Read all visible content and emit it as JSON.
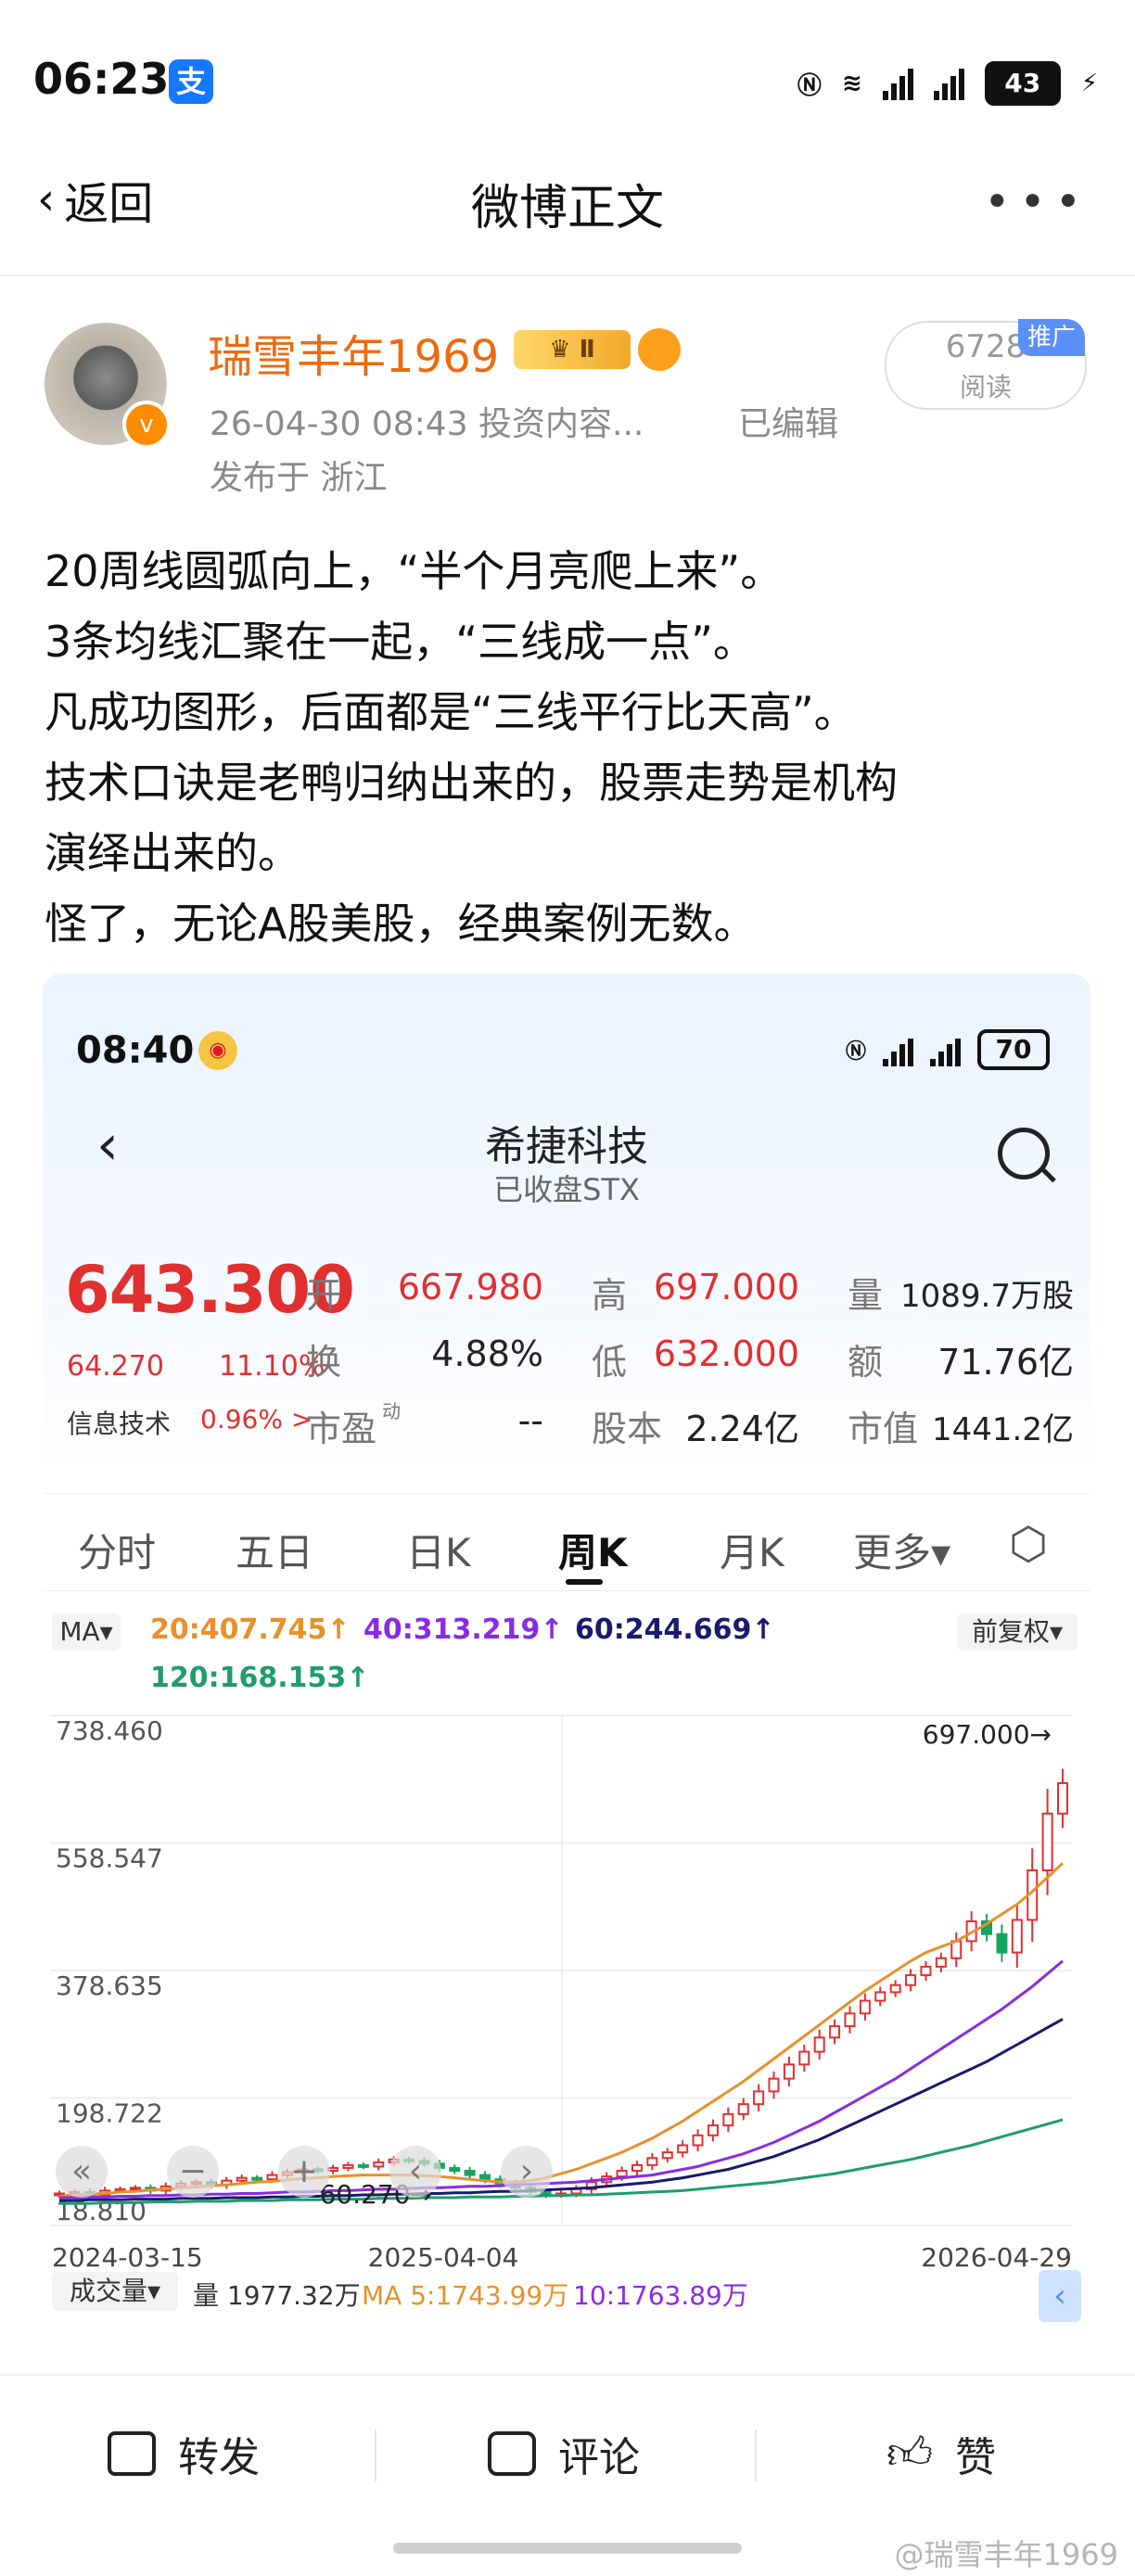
{
  "status_bar": {
    "time": "06:23",
    "alipay_icon": "支",
    "battery": "43"
  },
  "nav": {
    "back_label": "返回",
    "title": "微博正文",
    "more_icon": "•••"
  },
  "post": {
    "author": "瑞雪丰年1969",
    "vip_badge": "Ⅱ",
    "meta": "26-04-30 08:43  投资内容...",
    "edited": "已编辑",
    "location": "发布于 浙江",
    "reads_count": "6728",
    "reads_label": "阅读",
    "promo_label": "推广",
    "lines": [
      "20周线圆弧向上，“半个月亮爬上来”。",
      "3条均线汇聚在一起，“三线成一点”。",
      "凡成功图形，后面都是“三线平行比天高”。",
      "技术口诀是老鸭归纳出来的，股票走势是机构",
      "演绎出来的。",
      "怪了，无论A股美股，经典案例无数。"
    ]
  },
  "screenshot": {
    "time": "08:40",
    "battery": "70",
    "stock_name": "希捷科技",
    "stock_sub": "已收盘STX",
    "price": "643.300",
    "change": "64.270",
    "change_pct": "11.10%",
    "sector": "信息技术",
    "sector_pct": "0.96% >",
    "quote": {
      "open_label": "开",
      "open": "667.980",
      "high_label": "高",
      "high": "697.000",
      "vol_label": "量",
      "vol": "1089.7万股",
      "turn_label": "换",
      "turn": "4.88%",
      "low_label": "低",
      "low": "632.000",
      "amount_label": "额",
      "amount": "71.76亿",
      "pe_label": "市盈",
      "pe_sup": "动",
      "pe": "--",
      "shares_label": "股本",
      "shares": "2.24亿",
      "mcap_label": "市值",
      "mcap": "1441.2亿"
    },
    "tabs": [
      "分时",
      "五日",
      "日K",
      "周K",
      "月K",
      "更多▾"
    ],
    "active_tab": "周K",
    "ma_button": "MA▾",
    "fq_button": "前复权▾",
    "ma_legend": {
      "ma20": "20:407.745↑",
      "ma40": "40:313.219↑",
      "ma60": "60:244.669↑",
      "ma120": "120:168.153↑"
    },
    "volume": {
      "button": "成交量▾",
      "vol": "量 1977.32万",
      "ma5": "MA 5:1743.99万",
      "ma10": "10:1763.89万"
    },
    "colors": {
      "up": "#e0302f",
      "down": "#17a35f",
      "ma20": "#e8902c",
      "ma40": "#8a2be2",
      "ma60": "#1a1a6e",
      "ma120": "#1f9d6b"
    }
  },
  "chart_data": {
    "type": "candlestick",
    "y_ticks": [
      "738.460",
      "558.547",
      "378.635",
      "198.722",
      "18.810"
    ],
    "x_ticks": [
      "2024-03-15",
      "2025-04-04",
      "2026-04-29"
    ],
    "ylim": [
      18.81,
      738.46
    ],
    "annotations": {
      "high": "697.000→",
      "low": "60.270→"
    },
    "close_series": [
      64,
      66,
      62,
      68,
      70,
      72,
      68,
      74,
      78,
      80,
      76,
      82,
      86,
      84,
      90,
      94,
      98,
      96,
      100,
      104,
      102,
      108,
      112,
      110,
      106,
      100,
      96,
      90,
      84,
      78,
      72,
      66,
      62,
      64,
      70,
      80,
      88,
      96,
      104,
      114,
      122,
      132,
      146,
      160,
      176,
      190,
      208,
      226,
      246,
      264,
      284,
      300,
      318,
      336,
      348,
      358,
      372,
      384,
      396,
      420,
      448,
      430,
      404,
      450,
      520,
      600,
      643
    ],
    "ma20_series": [
      60,
      62,
      63,
      64,
      66,
      67,
      69,
      70,
      72,
      73,
      75,
      76,
      78,
      80,
      81,
      83,
      85,
      86,
      88,
      89,
      90,
      90,
      90,
      90,
      89,
      88,
      86,
      84,
      82,
      80,
      80,
      82,
      86,
      92,
      98,
      106,
      114,
      122,
      132,
      142,
      154,
      166,
      180,
      194,
      208,
      222,
      238,
      254,
      270,
      286,
      302,
      318,
      334,
      350,
      364,
      378,
      392,
      404,
      412,
      420,
      432,
      444,
      458,
      472,
      490,
      510,
      530
    ],
    "ma40_series": [
      58,
      58,
      59,
      59,
      60,
      60,
      61,
      61,
      62,
      62,
      63,
      63,
      64,
      64,
      65,
      66,
      66,
      67,
      68,
      68,
      69,
      70,
      70,
      71,
      72,
      72,
      73,
      74,
      74,
      75,
      76,
      77,
      78,
      79,
      80,
      82,
      84,
      86,
      88,
      90,
      94,
      98,
      102,
      108,
      114,
      120,
      128,
      136,
      146,
      156,
      166,
      178,
      190,
      202,
      214,
      226,
      240,
      254,
      268,
      282,
      296,
      310,
      324,
      340,
      356,
      374,
      392
    ],
    "ma60_series": [
      54,
      54,
      55,
      55,
      55,
      56,
      56,
      56,
      57,
      57,
      57,
      58,
      58,
      58,
      59,
      59,
      60,
      60,
      61,
      61,
      62,
      62,
      63,
      63,
      64,
      64,
      65,
      65,
      66,
      67,
      67,
      68,
      69,
      70,
      71,
      72,
      74,
      76,
      78,
      80,
      83,
      86,
      90,
      94,
      98,
      104,
      110,
      116,
      124,
      132,
      140,
      150,
      160,
      170,
      180,
      190,
      200,
      210,
      220,
      230,
      240,
      250,
      262,
      274,
      286,
      298,
      310
    ],
    "ma120_series": [
      50,
      50,
      50,
      51,
      51,
      51,
      52,
      52,
      52,
      53,
      53,
      53,
      54,
      54,
      54,
      55,
      55,
      55,
      56,
      56,
      56,
      57,
      57,
      57,
      58,
      58,
      58,
      59,
      59,
      59,
      60,
      60,
      61,
      61,
      62,
      62,
      63,
      64,
      65,
      66,
      67,
      68,
      70,
      72,
      74,
      76,
      78,
      80,
      83,
      86,
      89,
      92,
      96,
      100,
      104,
      108,
      112,
      117,
      122,
      127,
      132,
      138,
      144,
      150,
      156,
      162,
      168
    ]
  },
  "bottom_bar": {
    "repost": "转发",
    "comment": "评论",
    "like": "赞"
  },
  "watermark": "@瑞雪丰年1969"
}
